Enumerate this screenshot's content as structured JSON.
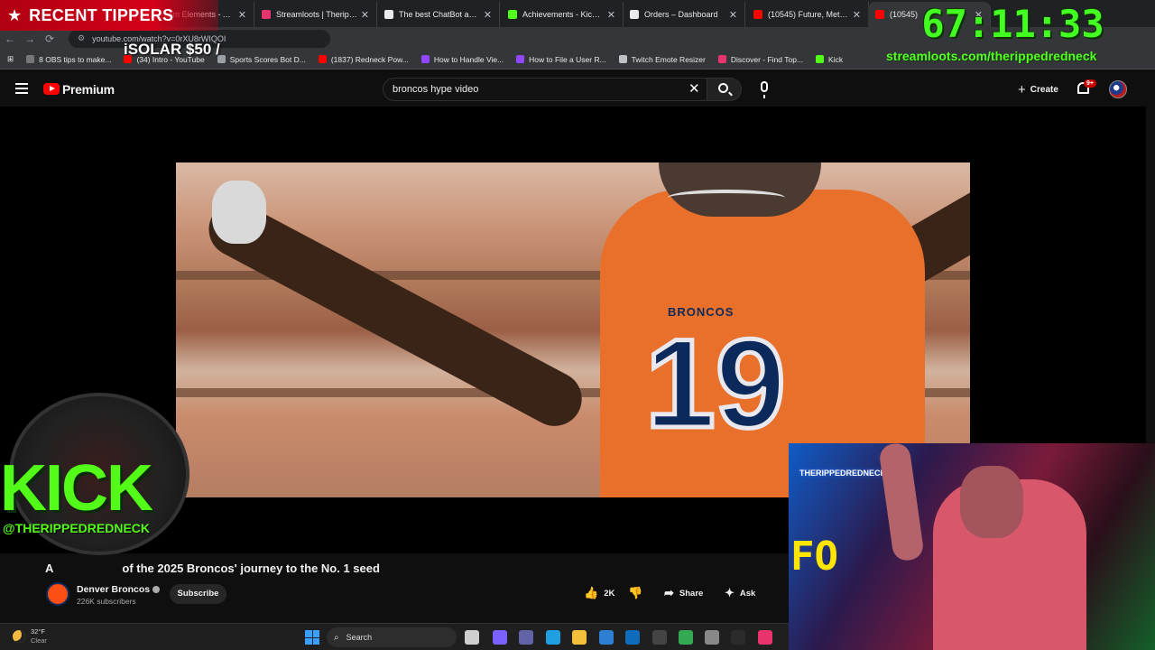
{
  "browser": {
    "tabs": [
      {
        "title": "Stream Elements - Appearances",
        "fav_color": "#f04e98",
        "active": false
      },
      {
        "title": "Streamloots | Therippedre",
        "fav_color": "#e8336e",
        "active": false
      },
      {
        "title": "The best ChatBot and Wi",
        "fav_color": "#e8eaed",
        "active": false
      },
      {
        "title": "Achievements - Kick Dash",
        "fav_color": "#53fc18",
        "active": false
      },
      {
        "title": "Orders – Dashboard",
        "fav_color": "#e8eaed",
        "active": false
      },
      {
        "title": "(10545) Future, Metro Bo",
        "fav_color": "#ff0000",
        "active": false
      },
      {
        "title": "(10545)",
        "fav_color": "#ff0000",
        "active": true
      }
    ],
    "url": "youtube.com/watch?v=0rXU8rWIQOI",
    "bookmarks": [
      {
        "label": "8 OBS tips to make...",
        "fav_color": "#777"
      },
      {
        "label": "(34) Intro - YouTube",
        "fav_color": "#ff0000"
      },
      {
        "label": "Sports Scores Bot D...",
        "fav_color": "#9aa0a6"
      },
      {
        "label": "(1837) Redneck Pow...",
        "fav_color": "#ff0000"
      },
      {
        "label": "How to Handle Vie...",
        "fav_color": "#9146ff"
      },
      {
        "label": "How to File a User R...",
        "fav_color": "#9146ff"
      },
      {
        "label": "Twitch Emote Resizer",
        "fav_color": "#bdc1c6"
      },
      {
        "label": "Discover - Find Top...",
        "fav_color": "#e8336e"
      },
      {
        "label": "Kick",
        "fav_color": "#53fc18"
      }
    ]
  },
  "youtube": {
    "brand": "Premium",
    "search_query": "broncos hype video",
    "create_label": "Create",
    "notif_badge": "9+",
    "video_title_visible": "of the 2025 Broncos' journey to the No. 1 seed",
    "video_title_prefix": "A",
    "jersey_word": "BRONCOS",
    "jersey_number": "19",
    "channel": {
      "name": "Denver Broncos",
      "subs": "226K subscribers"
    },
    "subscribe_label": "Subscribe",
    "actions": {
      "likes": "2K",
      "share": "Share",
      "ask": "Ask"
    }
  },
  "taskbar": {
    "temp": "32°F",
    "condition": "Clear",
    "search_label": "Search",
    "icons": [
      {
        "name": "task-view",
        "color": "#cfcfcf"
      },
      {
        "name": "copilot",
        "color": "#7b61ff"
      },
      {
        "name": "teams",
        "color": "#6264a7"
      },
      {
        "name": "edge",
        "color": "#1fa0e3"
      },
      {
        "name": "file-explorer",
        "color": "#f3c03a"
      },
      {
        "name": "store",
        "color": "#2d7fd3"
      },
      {
        "name": "outlook",
        "color": "#0f6cbd"
      },
      {
        "name": "obs",
        "color": "#444"
      },
      {
        "name": "chrome",
        "color": "#34a853"
      },
      {
        "name": "app-gray",
        "color": "#888"
      },
      {
        "name": "terminal",
        "color": "#2b2b2b"
      },
      {
        "name": "app-red",
        "color": "#e8336e"
      }
    ]
  },
  "overlays": {
    "tippers_title": "RECENT TIPPERS",
    "tip_entry": "iSOLAR $50 /",
    "timer": "67:11:33",
    "stream_link": "streamloots.com/therippedredneck",
    "kick_text": "KICK",
    "kick_handle": "@THERIPPEDREDNECK",
    "cam_neon": "THERIPPEDREDNECK",
    "cam_sign": "FO"
  }
}
